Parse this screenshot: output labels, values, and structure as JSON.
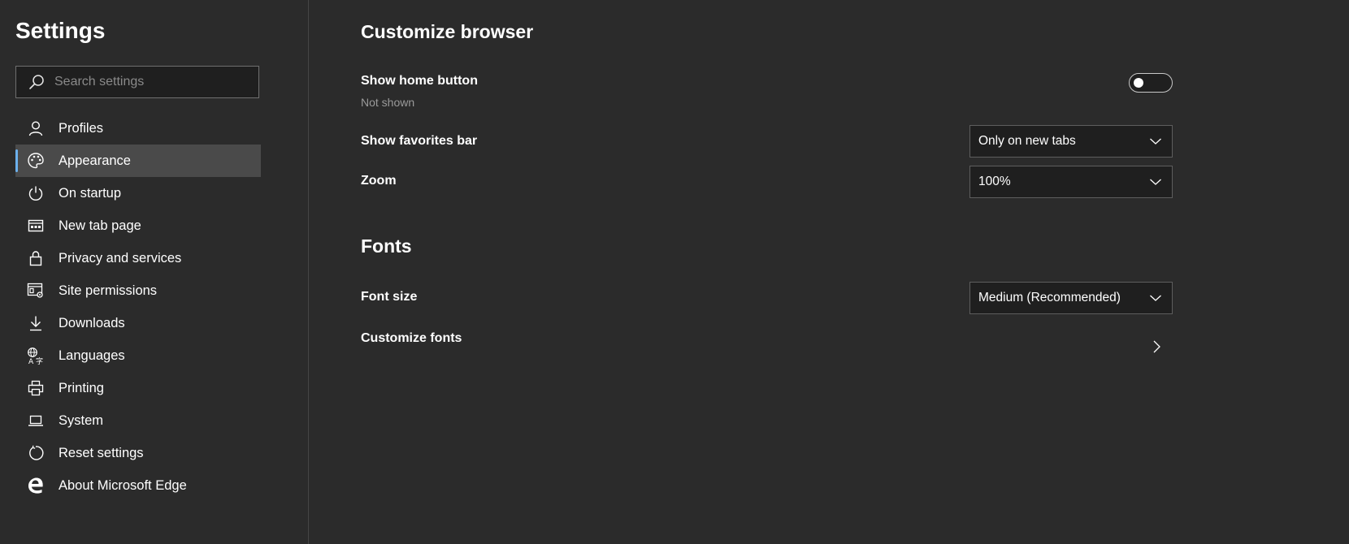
{
  "sidebar": {
    "title": "Settings",
    "search": {
      "placeholder": "Search settings",
      "value": ""
    },
    "items": [
      {
        "label": "Profiles",
        "icon": "person-icon",
        "active": false
      },
      {
        "label": "Appearance",
        "icon": "palette-icon",
        "active": true
      },
      {
        "label": "On startup",
        "icon": "power-icon",
        "active": false
      },
      {
        "label": "New tab page",
        "icon": "new-tab-page-icon",
        "active": false
      },
      {
        "label": "Privacy and services",
        "icon": "lock-icon",
        "active": false
      },
      {
        "label": "Site permissions",
        "icon": "site-permissions-icon",
        "active": false
      },
      {
        "label": "Downloads",
        "icon": "download-icon",
        "active": false
      },
      {
        "label": "Languages",
        "icon": "languages-icon",
        "active": false
      },
      {
        "label": "Printing",
        "icon": "printer-icon",
        "active": false
      },
      {
        "label": "System",
        "icon": "laptop-icon",
        "active": false
      },
      {
        "label": "Reset settings",
        "icon": "reset-icon",
        "active": false
      },
      {
        "label": "About Microsoft Edge",
        "icon": "edge-logo-icon",
        "active": false
      }
    ],
    "accent_color": "#6cb0ec"
  },
  "main": {
    "customize_browser": {
      "title": "Customize browser",
      "show_home_button": {
        "label": "Show home button",
        "sub": "Not shown",
        "enabled": false
      },
      "show_favorites_bar": {
        "label": "Show favorites bar",
        "value": "Only on new tabs"
      },
      "zoom": {
        "label": "Zoom",
        "value": "100%"
      }
    },
    "fonts": {
      "title": "Fonts",
      "font_size": {
        "label": "Font size",
        "value": "Medium (Recommended)"
      },
      "customize_fonts": {
        "label": "Customize fonts"
      }
    }
  }
}
